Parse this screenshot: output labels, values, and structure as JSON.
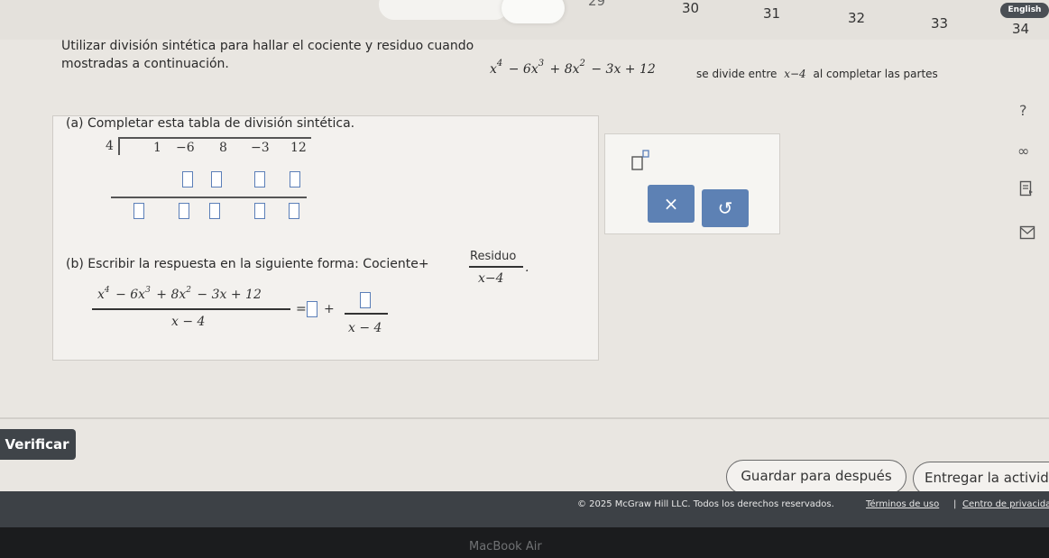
{
  "nav": {
    "questions": [
      "30",
      "31",
      "32",
      "33",
      "34"
    ],
    "partial_prev": "29",
    "language": "English"
  },
  "prompt": {
    "line1_prefix": "Utilizar división sintética para hallar el cociente y residuo cuando",
    "line1_suffix_a": "se divide entre",
    "divisor_expr": "x−4",
    "line1_suffix_b": "al completar las partes",
    "line2": "mostradas a continuación.",
    "poly": {
      "t1": "x",
      "e1": "4",
      "t2": " − 6x",
      "e2": "3",
      "t3": " + 8x",
      "e3": "2",
      "t4": " − 3x + 12"
    }
  },
  "part_a": {
    "label": "(a) Completar esta tabla de división sintética.",
    "divisor": "4",
    "coefficients": [
      "1",
      "−6",
      "8",
      "−3",
      "12"
    ]
  },
  "part_b": {
    "label_prefix": "(b) Escribir la respuesta en la siguiente forma: Cociente+",
    "residuo_word": "Residuo",
    "denominator": "x−4",
    "lhs_den": "x − 4",
    "rhs_den": "x − 4",
    "equals": "=",
    "plus": "+",
    "period": "."
  },
  "tools": {
    "clear_symbol": "×",
    "undo_symbol": "↺"
  },
  "side_icons": [
    "?",
    "∞"
  ],
  "bottom": {
    "verify": "Verificar",
    "save_later": "Guardar para después",
    "submit": "Entregar la actividad"
  },
  "footer": {
    "copyright": "© 2025 McGraw Hill LLC. Todos los derechos reservados.",
    "terms": "Términos de uso",
    "separator": "|",
    "privacy": "Centro de privacidad"
  },
  "bezel": "MacBook Air",
  "colors": {
    "accent": "#5d81b4",
    "input_border": "#5b7fb8",
    "dark_button": "#3f4449",
    "footer_bg": "#3d4146"
  }
}
